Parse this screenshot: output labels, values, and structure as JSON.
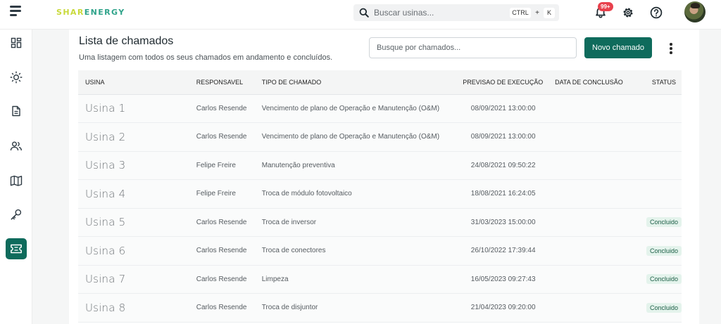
{
  "header": {
    "logo_part1": "SHAR",
    "logo_part2": "ENERGY",
    "search_placeholder": "Buscar usinas...",
    "shortcut_ctrl": "CTRL",
    "shortcut_plus": "+",
    "shortcut_key": "K",
    "notifications_badge": "99+",
    "icons": [
      "menu-icon",
      "search-icon",
      "bell-icon",
      "gear-icon",
      "help-icon"
    ]
  },
  "sidebar": {
    "items": [
      {
        "name": "dashboard",
        "icon": "dashboard-icon",
        "active": false
      },
      {
        "name": "generation",
        "icon": "sun-icon",
        "active": false
      },
      {
        "name": "reports",
        "icon": "document-icon",
        "active": false
      },
      {
        "name": "users",
        "icon": "users-icon",
        "active": false
      },
      {
        "name": "map",
        "icon": "map-icon",
        "active": false
      },
      {
        "name": "keys",
        "icon": "key-icon",
        "active": false
      },
      {
        "name": "tickets",
        "icon": "ticket-icon",
        "active": true
      }
    ],
    "accent": "#0f6b5c"
  },
  "main": {
    "title": "Lista de chamados",
    "subtitle": "Uma listagem com todos os seus chamados em andamento e concluídos.",
    "search_placeholder": "Busque por chamados...",
    "new_button": "Novo chamado",
    "columns": {
      "usina": "USINA",
      "responsavel": "RESPONSAVEL",
      "tipo": "TIPO DE CHAMADO",
      "previsao": "PREVISAO DE EXECUÇÃO",
      "conclusao": "DATA DE CONCLUSÃO",
      "status": "STATUS"
    },
    "rows": [
      {
        "usina": "Usina 1",
        "responsavel": "Carlos Resende",
        "tipo": "Vencimento de plano de Operação e Manutenção (O&M)",
        "previsao": "08/09/2021 13:00:00",
        "conclusao": "",
        "status": ""
      },
      {
        "usina": "Usina 2",
        "responsavel": "Carlos Resende",
        "tipo": "Vencimento de plano de Operação e Manutenção (O&M)",
        "previsao": "08/09/2021 13:00:00",
        "conclusao": "",
        "status": ""
      },
      {
        "usina": "Usina 3",
        "responsavel": "Felipe Freire",
        "tipo": "Manutenção preventiva",
        "previsao": "24/08/2021 09:50:22",
        "conclusao": "",
        "status": ""
      },
      {
        "usina": "Usina 4",
        "responsavel": "Felipe Freire",
        "tipo": "Troca de módulo fotovoltaico",
        "previsao": "18/08/2021 16:24:05",
        "conclusao": "",
        "status": ""
      },
      {
        "usina": "Usina 5",
        "responsavel": "Carlos Resende",
        "tipo": "Troca de inversor",
        "previsao": "31/03/2023 15:00:00",
        "conclusao": "",
        "status": "Concluido"
      },
      {
        "usina": "Usina 6",
        "responsavel": "Carlos Resende",
        "tipo": "Troca de conectores",
        "previsao": "26/10/2022 17:39:44",
        "conclusao": "",
        "status": "Concluido"
      },
      {
        "usina": "Usina 7",
        "responsavel": "Carlos Resende",
        "tipo": "Limpeza",
        "previsao": "16/05/2023 09:27:43",
        "conclusao": "",
        "status": "Concluido"
      },
      {
        "usina": "Usina 8",
        "responsavel": "Carlos Resende",
        "tipo": "Troca de disjuntor",
        "previsao": "21/04/2023 09:20:00",
        "conclusao": "",
        "status": "Concluido"
      }
    ]
  },
  "colors": {
    "primary": "#0f6b5c",
    "badge_red": "#e8414d",
    "status_bg": "#e4f3ec"
  }
}
